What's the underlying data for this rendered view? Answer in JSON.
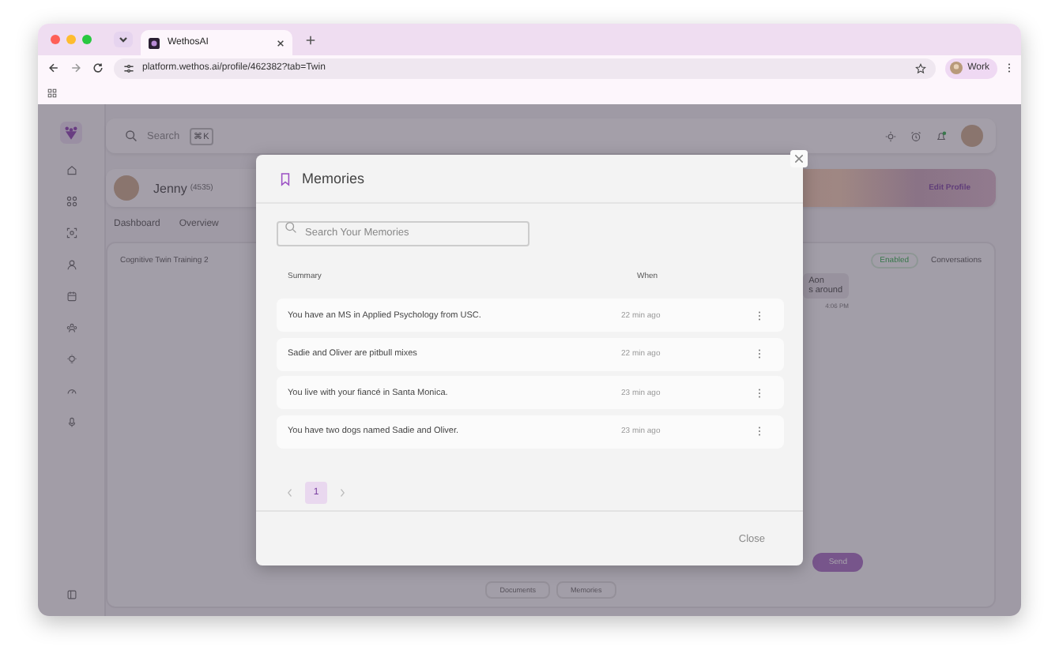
{
  "browser": {
    "tab_title": "WethosAI",
    "url": "platform.wethos.ai/profile/462382?tab=Twin",
    "profile": "Work"
  },
  "topbar": {
    "search_placeholder": "Search",
    "shortcut": "⌘K"
  },
  "profile": {
    "name": "Jenny",
    "id": "(4535)",
    "edit": "Edit Profile"
  },
  "tabs": [
    {
      "label": "Dashboard"
    },
    {
      "label": "Overview"
    }
  ],
  "chat": {
    "title": "Cognitive Twin Training 2",
    "status": "Enabled",
    "conversations": "Conversations",
    "message_lines": [
      "Aon",
      "s around"
    ],
    "time": "4:06 PM",
    "send": "Send",
    "footer_buttons": [
      "Documents",
      "Memories"
    ]
  },
  "modal": {
    "title": "Memories",
    "search_placeholder": "Search Your Memories",
    "columns": [
      "Summary",
      "When"
    ],
    "rows": [
      {
        "summary": "You have an MS in Applied Psychology from USC.",
        "when": "22 min ago"
      },
      {
        "summary": "Sadie and Oliver are pitbull mixes",
        "when": "22 min ago"
      },
      {
        "summary": "You live with your fiancé in Santa Monica.",
        "when": "23 min ago"
      },
      {
        "summary": "You have two dogs named Sadie and Oliver.",
        "when": "23 min ago"
      }
    ],
    "pages": [
      {
        "label": "1",
        "selected": true
      }
    ],
    "close": "Close"
  }
}
